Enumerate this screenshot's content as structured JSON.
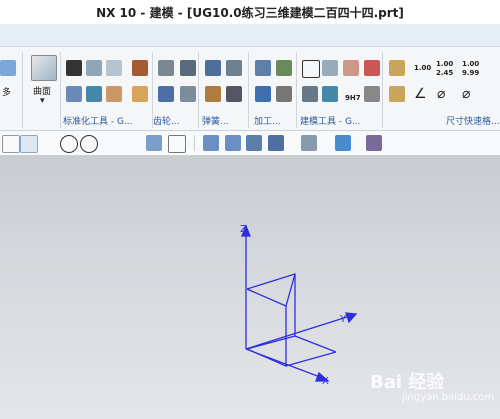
{
  "window": {
    "title": "NX 10 - 建模 - [UG10.0练习三维建模二百四十四.prt]"
  },
  "ribbon": {
    "left_partial_label": "多",
    "surface_label": "曲面",
    "groups": [
      {
        "name": "标准化工具 - G...",
        "color": "#2a5a9a"
      },
      {
        "name": "齿轮...",
        "color": "#2a5a9a"
      },
      {
        "name": "弹簧...",
        "color": "#2a5a9a"
      },
      {
        "name": "加工...",
        "color": "#2a5a9a"
      },
      {
        "name": "建模工具 - G...",
        "color": "#2a5a9a"
      },
      {
        "name": "尺寸快速格...",
        "color": "#2a5a9a"
      }
    ],
    "dim_labels": {
      "a": "1.00",
      "b_top": "1.00",
      "b_bottom": "2.45",
      "c_top": "1.00",
      "c_bottom": "9.99"
    },
    "part_tag": "9H7"
  },
  "axes": {
    "x": "X",
    "y": "Y",
    "z": "Z",
    "color": "#2f2fe0"
  },
  "watermark": {
    "brand": "Bai 经验",
    "url": "jingyan.baidu.com"
  }
}
